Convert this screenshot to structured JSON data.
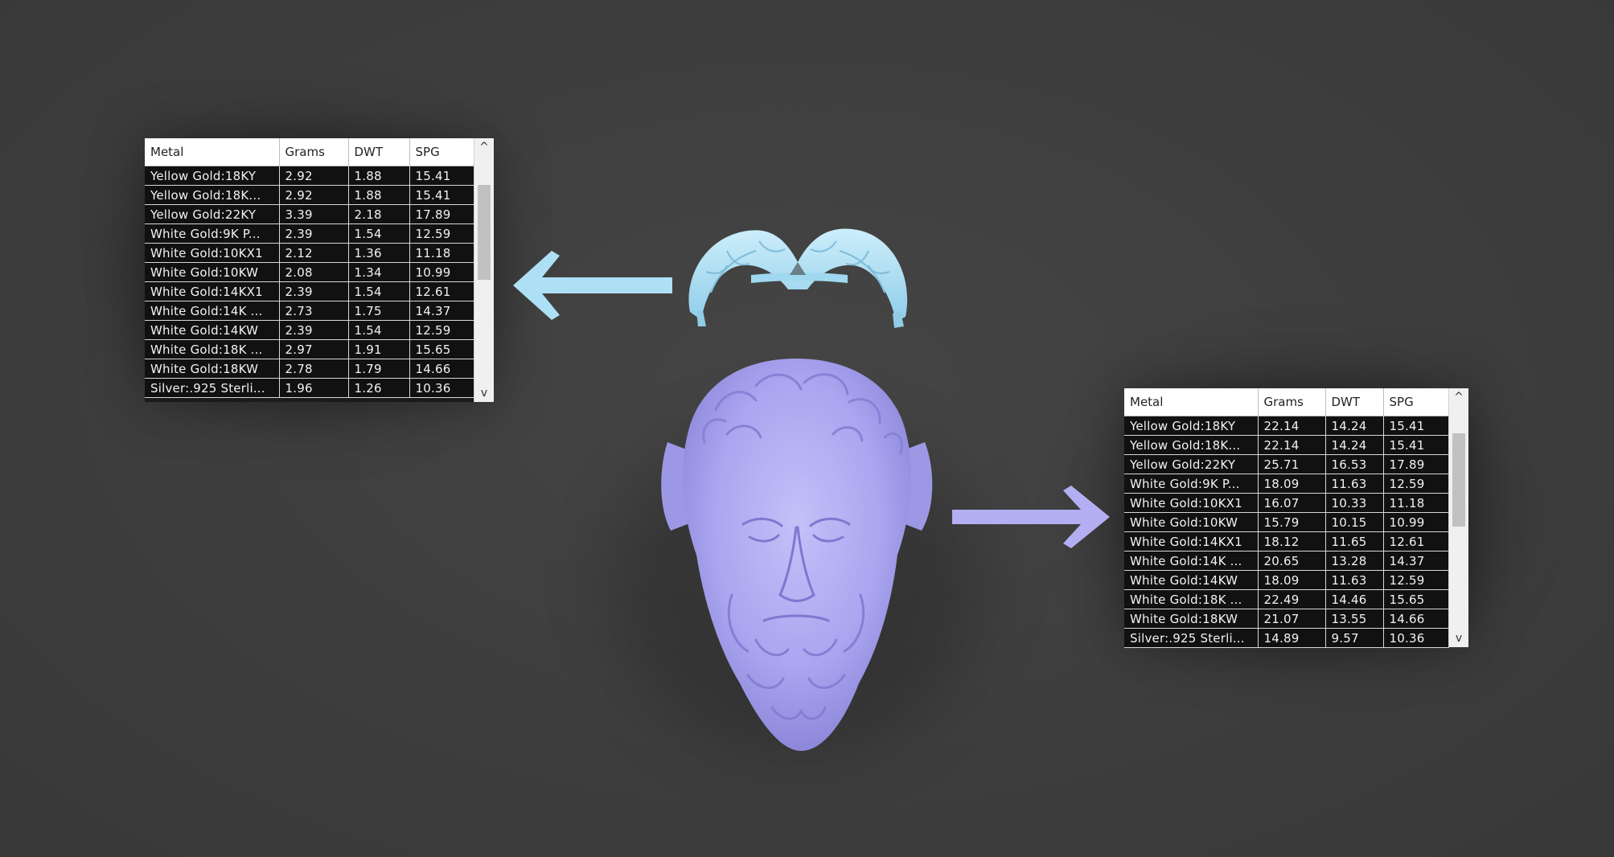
{
  "tables": {
    "left": {
      "headers": [
        "Metal",
        "Grams",
        "DWT",
        "SPG"
      ],
      "rows": [
        [
          "Yellow Gold:18KY",
          "2.92",
          "1.88",
          "15.41"
        ],
        [
          "Yellow Gold:18K...",
          "2.92",
          "1.88",
          "15.41"
        ],
        [
          "Yellow Gold:22KY",
          "3.39",
          "2.18",
          "17.89"
        ],
        [
          "White Gold:9K P...",
          "2.39",
          "1.54",
          "12.59"
        ],
        [
          "White Gold:10KX1",
          "2.12",
          "1.36",
          "11.18"
        ],
        [
          "White Gold:10KW",
          "2.08",
          "1.34",
          "10.99"
        ],
        [
          "White Gold:14KX1",
          "2.39",
          "1.54",
          "12.61"
        ],
        [
          "White Gold:14K ...",
          "2.73",
          "1.75",
          "14.37"
        ],
        [
          "White Gold:14KW",
          "2.39",
          "1.54",
          "12.59"
        ],
        [
          "White Gold:18K ...",
          "2.97",
          "1.91",
          "15.65"
        ],
        [
          "White Gold:18KW",
          "2.78",
          "1.79",
          "14.66"
        ],
        [
          "Silver:.925 Sterli...",
          "1.96",
          "1.26",
          "10.36"
        ]
      ]
    },
    "right": {
      "headers": [
        "Metal",
        "Grams",
        "DWT",
        "SPG"
      ],
      "rows": [
        [
          "Yellow Gold:18KY",
          "22.14",
          "14.24",
          "15.41"
        ],
        [
          "Yellow Gold:18K...",
          "22.14",
          "14.24",
          "15.41"
        ],
        [
          "Yellow Gold:22KY",
          "25.71",
          "16.53",
          "17.89"
        ],
        [
          "White Gold:9K P...",
          "18.09",
          "11.63",
          "12.59"
        ],
        [
          "White Gold:10KX1",
          "16.07",
          "10.33",
          "11.18"
        ],
        [
          "White Gold:10KW",
          "15.79",
          "10.15",
          "10.99"
        ],
        [
          "White Gold:14KX1",
          "18.12",
          "11.65",
          "12.61"
        ],
        [
          "White Gold:14K ...",
          "20.65",
          "13.28",
          "14.37"
        ],
        [
          "White Gold:14KW",
          "18.09",
          "11.63",
          "12.59"
        ],
        [
          "White Gold:18K ...",
          "22.49",
          "14.46",
          "15.65"
        ],
        [
          "White Gold:18KW",
          "21.07",
          "13.55",
          "14.66"
        ],
        [
          "Silver:.925 Sterli...",
          "14.89",
          "9.57",
          "10.36"
        ]
      ]
    }
  },
  "scroll": {
    "up_glyph": "^",
    "down_glyph": "v"
  },
  "colors": {
    "background": "#3f3f3f",
    "crown_model": "#aee0f5",
    "crown_arrow": "#aee0f5",
    "head_model": "#aaa6f0",
    "head_arrow": "#b4aef3"
  },
  "icons": {
    "crown_model": "laurel-crown-ring-model",
    "head_model": "bearded-head-ring-model",
    "crown_arrow": "arrow-left-icon",
    "head_arrow": "arrow-right-icon"
  }
}
